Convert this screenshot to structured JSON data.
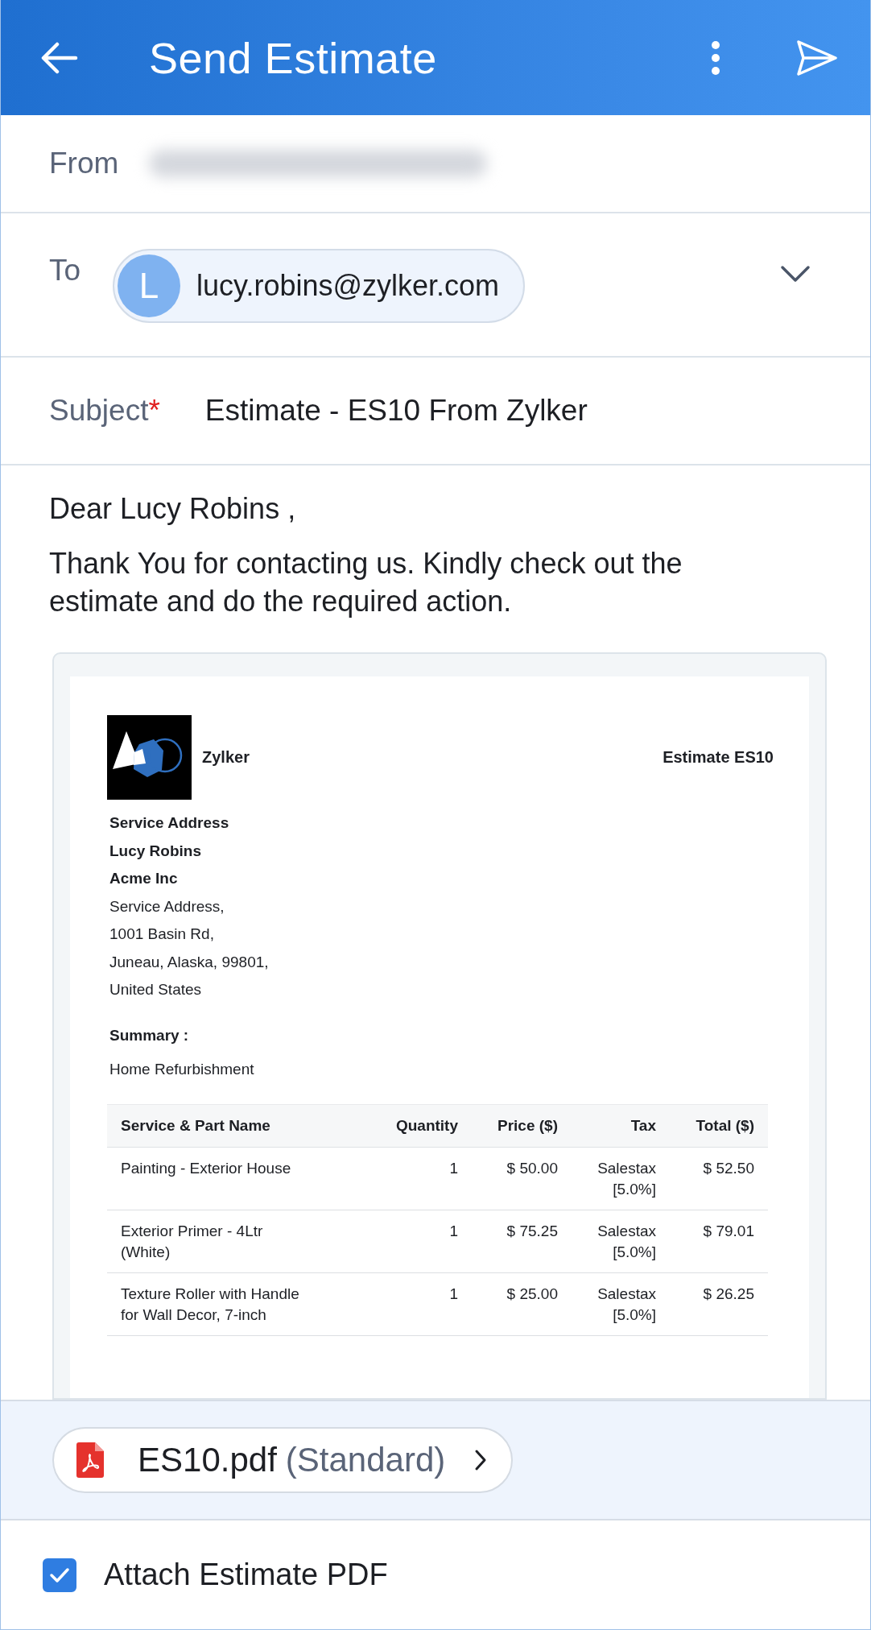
{
  "header": {
    "title": "Send Estimate"
  },
  "from": {
    "label": "From"
  },
  "to": {
    "label": "To",
    "recipients": [
      {
        "initial": "L",
        "email": "lucy.robins@zylker.com"
      }
    ]
  },
  "subject": {
    "label": "Subject",
    "required_mark": "*",
    "value": "Estimate - ES10 From Zylker"
  },
  "body": {
    "greeting": "Dear Lucy Robins ,",
    "paragraph": "Thank You for contacting us. Kindly check out the estimate and do the required action."
  },
  "document": {
    "company": "Zylker",
    "title": "Estimate ES10",
    "address_lines": [
      {
        "text": "Service Address",
        "bold": true
      },
      {
        "text": "Lucy Robins",
        "bold": true
      },
      {
        "text": "Acme Inc",
        "bold": true
      },
      {
        "text": "Service Address,",
        "bold": false
      },
      {
        "text": "1001 Basin Rd,",
        "bold": false
      },
      {
        "text": "Juneau, Alaska, 99801,",
        "bold": false
      },
      {
        "text": "United States",
        "bold": false
      }
    ],
    "summary_label": "Summary :",
    "summary": "Home Refurbishment",
    "table": {
      "columns": [
        "Service & Part Name",
        "Quantity",
        "Price ($)",
        "Tax",
        "Total ($)"
      ],
      "rows": [
        [
          "Painting - Exterior House",
          "1",
          "$ 50.00",
          "Salestax [5.0%]",
          "$ 52.50"
        ],
        [
          "Exterior Primer - 4Ltr (White)",
          "1",
          "$ 75.25",
          "Salestax [5.0%]",
          "$ 79.01"
        ],
        [
          "Texture Roller with Handle for Wall Decor, 7-inch",
          "1",
          "$ 25.00",
          "Salestax [5.0%]",
          "$ 26.25"
        ]
      ]
    }
  },
  "attachment": {
    "file_name": "ES10.pdf",
    "variant": "(Standard)"
  },
  "attach_pdf": {
    "label": "Attach Estimate PDF",
    "checked": true
  }
}
